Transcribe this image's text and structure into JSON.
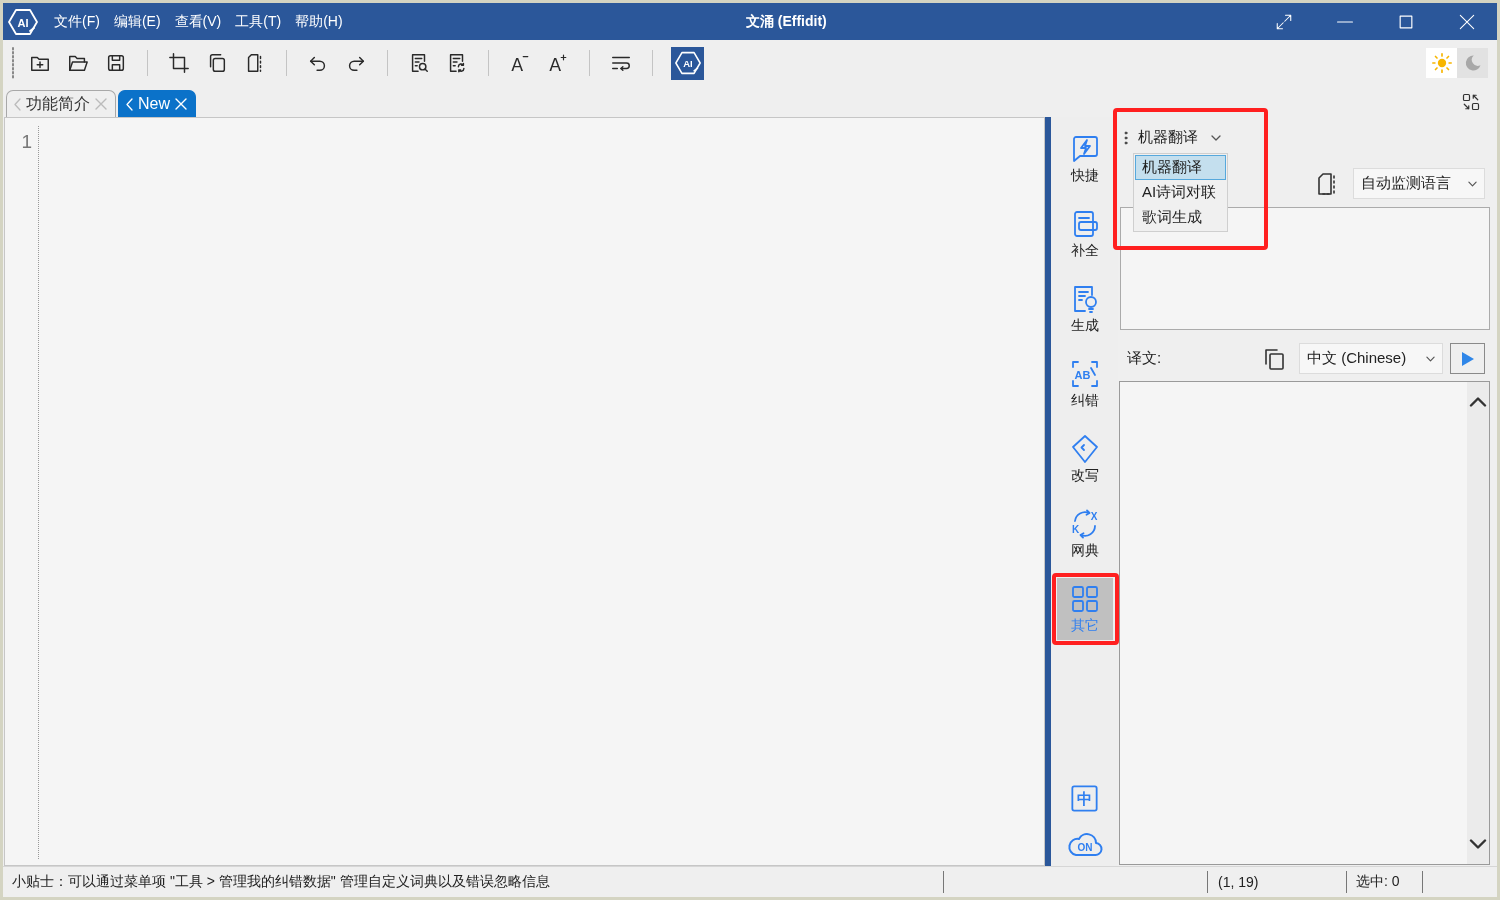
{
  "window": {
    "logo": "AI",
    "title": "文涌 (Effidit)",
    "menu": [
      "文件(F)",
      "编辑(E)",
      "查看(V)",
      "工具(T)",
      "帮助(H)"
    ]
  },
  "toolbar": {
    "font_buttons": [
      {
        "kind": "decrease",
        "glyph": "A"
      },
      {
        "kind": "increase",
        "glyph": "A"
      }
    ],
    "ai_button": "AI",
    "theme_toggle": [
      {
        "kind": "light",
        "selected": true
      },
      {
        "kind": "dark",
        "selected": false
      }
    ]
  },
  "tabs": [
    {
      "label": "功能简介",
      "selected": false
    },
    {
      "label": "New",
      "selected": true
    }
  ],
  "editor": {
    "line_numbers": [
      "1"
    ]
  },
  "side_nav": {
    "items": [
      {
        "label": "快捷",
        "selected": false,
        "highlighted": false
      },
      {
        "label": "补全",
        "selected": false,
        "highlighted": false
      },
      {
        "label": "生成",
        "selected": false,
        "highlighted": false
      },
      {
        "label": "纠错",
        "icon_text": [
          "AB"
        ],
        "selected": false,
        "highlighted": false
      },
      {
        "label": "改写",
        "selected": false,
        "highlighted": false
      },
      {
        "label": "网典",
        "icon_text": [
          "X",
          "K"
        ],
        "selected": false,
        "highlighted": false
      },
      {
        "label": "其它",
        "selected": true,
        "highlighted": true
      }
    ],
    "bottom_buttons": [
      {
        "kind": "language",
        "glyph": "中"
      },
      {
        "kind": "cloud",
        "glyph": "ON"
      }
    ]
  },
  "translate_panel": {
    "mode": {
      "label": "机器翻译",
      "expanded": true,
      "highlighted": true,
      "options": [
        {
          "label": "机器翻译",
          "selected": true
        },
        {
          "label": "AI诗词对联",
          "selected": false
        },
        {
          "label": "歌词生成",
          "selected": false
        }
      ]
    },
    "source": {
      "language": "自动监测语言"
    },
    "target": {
      "label": "译文:",
      "language": "中文 (Chinese)"
    }
  },
  "status_bar": {
    "tip": "小贴士：可以通过菜单项 \"工具 > 管理我的纠错数据\" 管理自定义词典以及错误忽略信息",
    "position": "(1, 19)",
    "selection": "选中: 0"
  }
}
